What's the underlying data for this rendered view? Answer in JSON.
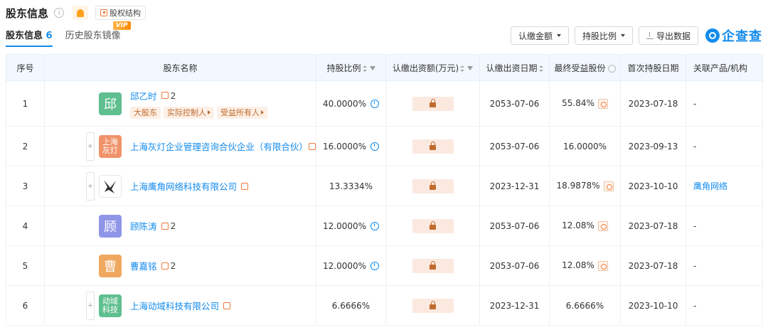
{
  "header": {
    "title": "股东信息",
    "equity_label": "股权结构"
  },
  "tabs": [
    {
      "label": "股东信息",
      "count": "6"
    },
    {
      "label": "历史股东镜像",
      "badge": "VIP"
    }
  ],
  "toolbar": {
    "amount_label": "认缴金额",
    "ratio_label": "持股比例",
    "export_label": "导出数据",
    "brand": "企查查"
  },
  "columns": [
    "序号",
    "股东名称",
    "持股比例",
    "认缴出资额(万元)",
    "认缴出资日期",
    "最终受益股份",
    "首次持股日期",
    "关联产品/机构"
  ],
  "rows": [
    {
      "index": "1",
      "avatar": "邱",
      "avatar_color": "#5fbf8f",
      "name": "邱乙时",
      "rel_count": "2",
      "tags": [
        "大股东",
        "实际控制人",
        "受益所有人"
      ],
      "ratio": "40.0000%",
      "date": "2053-07-06",
      "benefit": "55.84%",
      "first_date": "2023-07-18",
      "related": "-"
    },
    {
      "index": "2",
      "avatar": "上海灰灯",
      "avatar_color": "#f0936a",
      "name": "上海灰灯企业管理咨询合伙企业（有限合伙）",
      "ratio": "16.0000%",
      "date": "2053-07-06",
      "benefit": "16.0000%",
      "first_date": "2023-09-13",
      "related": "-"
    },
    {
      "index": "3",
      "avatar": "",
      "avatar_color": "#ffffff",
      "name": "上海鹰角网络科技有限公司",
      "ratio": "13.3334%",
      "date": "2023-12-31",
      "benefit": "18.9878%",
      "first_date": "2023-10-10",
      "related": "鹰角网络"
    },
    {
      "index": "4",
      "avatar": "顾",
      "avatar_color": "#8f96e8",
      "name": "顾陈涛",
      "rel_count": "2",
      "ratio": "12.0000%",
      "date": "2053-07-06",
      "benefit": "12.08%",
      "first_date": "2023-07-18",
      "related": "-"
    },
    {
      "index": "5",
      "avatar": "曹",
      "avatar_color": "#f0a860",
      "name": "曹嘉铭",
      "rel_count": "2",
      "ratio": "12.0000%",
      "date": "2053-07-06",
      "benefit": "12.08%",
      "first_date": "2023-07-18",
      "related": "-"
    },
    {
      "index": "6",
      "avatar": "动域科技",
      "avatar_color": "#5fbf8f",
      "name": "上海动域科技有限公司",
      "ratio": "6.6666%",
      "date": "2023-12-31",
      "benefit": "6.6666%",
      "first_date": "2023-10-10",
      "related": "-"
    }
  ]
}
